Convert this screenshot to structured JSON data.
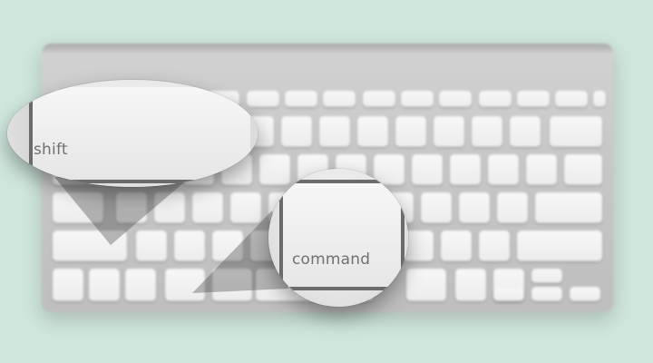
{
  "scene": {
    "background_color": "#cfe6dc",
    "keyboard_color": "#c8c8c8",
    "keycap_color": "#f0f0f0",
    "accent_line_color": "#6b6b6b"
  },
  "callouts": {
    "shift": {
      "label": "shift",
      "icon": "shift-key-icon"
    },
    "command": {
      "label": "command",
      "icon": "command-key-icon"
    }
  }
}
